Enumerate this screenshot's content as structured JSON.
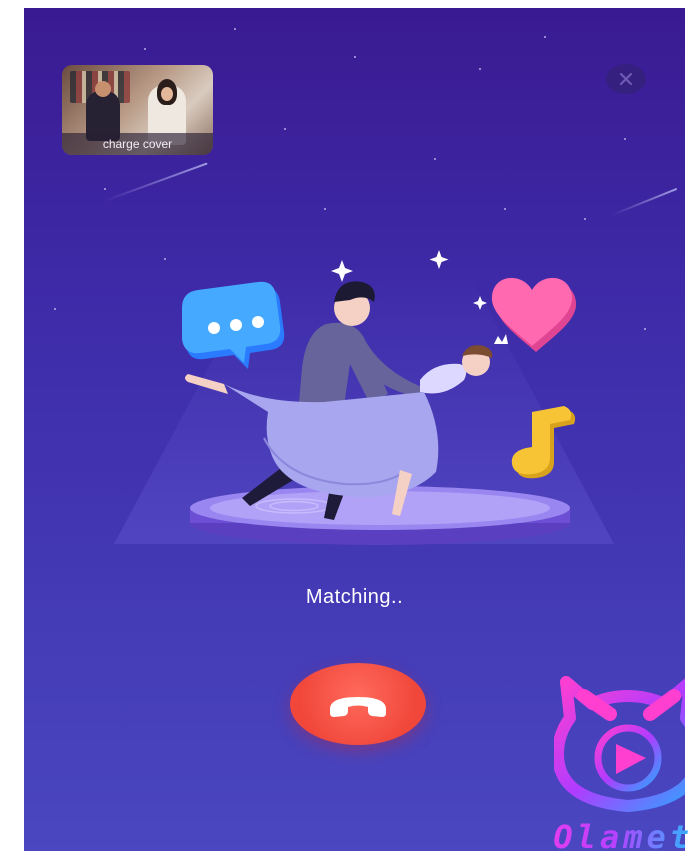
{
  "preview": {
    "caption": "charge cover"
  },
  "status": {
    "matching_text": "Matching.."
  },
  "controls": {
    "close_icon": "close-icon",
    "hangup_icon": "phone-hangup-icon"
  },
  "brand": {
    "name": "Olamet"
  },
  "colors": {
    "background_top": "#3a1a92",
    "background_bottom": "#4a47c0",
    "hangup": "#f0473a",
    "heart": "#ff5fa7",
    "chat_bubble": "#3fa4ff",
    "music_note": "#f4c232",
    "brand_magenta": "#e23df0",
    "brand_cyan": "#2fb6ff"
  }
}
